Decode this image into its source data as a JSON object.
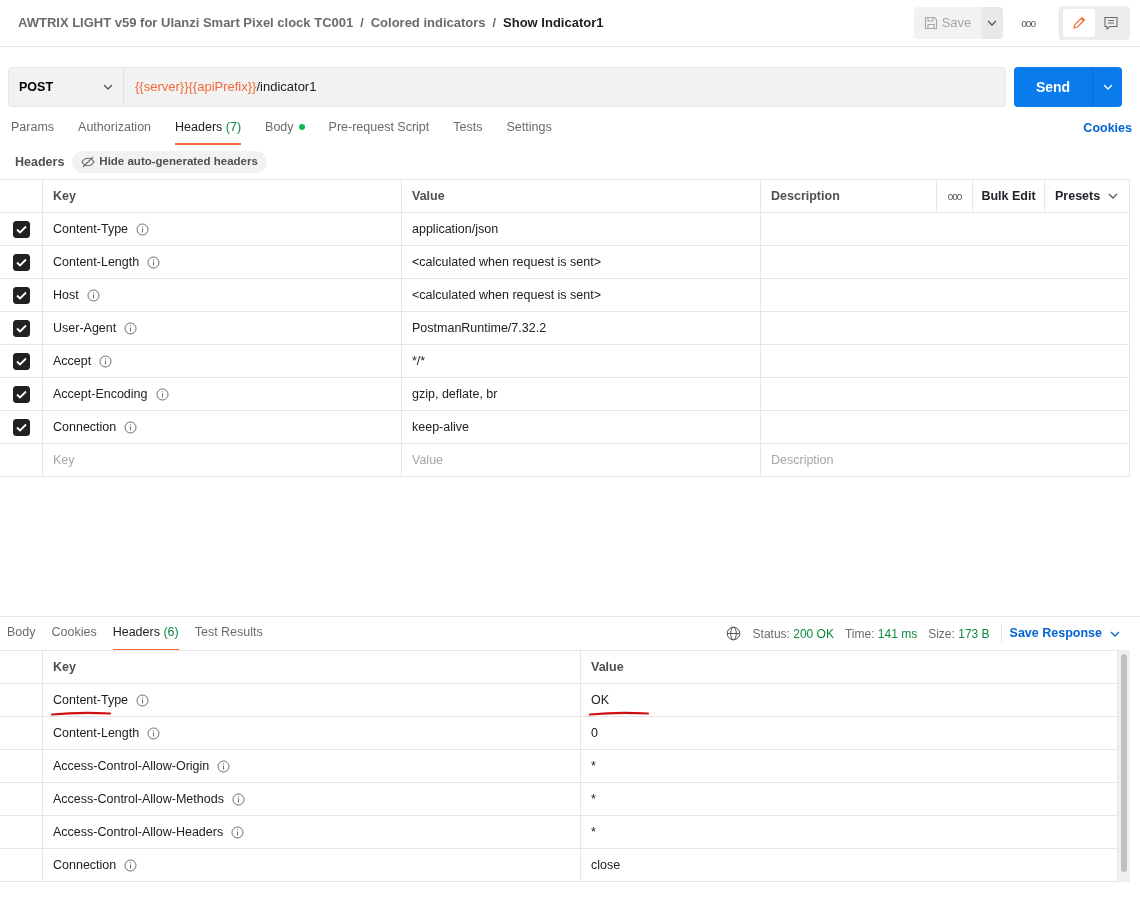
{
  "breadcrumb": [
    {
      "label": "AWTRIX LIGHT v59 for Ulanzi Smart Pixel clock TC001",
      "selected": false
    },
    {
      "label": "Colored indicators",
      "selected": false
    },
    {
      "label": "Show Indicator1",
      "selected": true
    }
  ],
  "breadcrumb_separator": "/",
  "save_button": {
    "label": "Save",
    "disabled": true
  },
  "more_button": "ooo",
  "request": {
    "method": "POST",
    "url_variables": [
      "{{server}}",
      "{{apiPrefix}}"
    ],
    "url_path": "/indicator1",
    "send": "Send"
  },
  "request_tabs": [
    {
      "label": "Params",
      "selected": false
    },
    {
      "label": "Authorization",
      "selected": false
    },
    {
      "label": "Headers",
      "count": "(7)",
      "selected": true
    },
    {
      "label": "Body",
      "dot": true,
      "selected": false
    },
    {
      "label": "Pre-request Script",
      "selected": false
    },
    {
      "label": "Tests",
      "selected": false
    },
    {
      "label": "Settings",
      "selected": false
    }
  ],
  "cookies_link": "Cookies",
  "headers_bar": {
    "title": "Headers",
    "toggle": "Hide auto-generated headers"
  },
  "headers_table": {
    "columns": [
      "Key",
      "Value",
      "Description"
    ],
    "more": "ooo",
    "bulk_edit": "Bulk Edit",
    "presets": "Presets",
    "rows": [
      {
        "key": "Content-Type",
        "value": "application/json",
        "checked": true
      },
      {
        "key": "Content-Length",
        "value": "<calculated when request is sent>",
        "checked": true
      },
      {
        "key": "Host",
        "value": "<calculated when request is sent>",
        "checked": true
      },
      {
        "key": "User-Agent",
        "value": "PostmanRuntime/7.32.2",
        "checked": true
      },
      {
        "key": "Accept",
        "value": "*/*",
        "checked": true
      },
      {
        "key": "Accept-Encoding",
        "value": "gzip, deflate, br",
        "checked": true
      },
      {
        "key": "Connection",
        "value": "keep-alive",
        "checked": true
      }
    ],
    "new_row": {
      "key_placeholder": "Key",
      "value_placeholder": "Value",
      "description_placeholder": "Description"
    }
  },
  "response_tabs": [
    {
      "label": "Body",
      "selected": false
    },
    {
      "label": "Cookies",
      "selected": false
    },
    {
      "label": "Headers",
      "count": "(6)",
      "selected": true
    },
    {
      "label": "Test Results",
      "selected": false
    }
  ],
  "response_meta": [
    {
      "label": "Status:",
      "value": "200 OK"
    },
    {
      "label": "Time:",
      "value": "141 ms"
    },
    {
      "label": "Size:",
      "value": "173 B"
    }
  ],
  "save_response": "Save Response",
  "response_table": {
    "columns": [
      "Key",
      "Value"
    ],
    "rows": [
      {
        "key": "Content-Type",
        "value": "OK",
        "marked": true
      },
      {
        "key": "Content-Length",
        "value": "0",
        "marked": false
      },
      {
        "key": "Access-Control-Allow-Origin",
        "value": "*",
        "marked": false
      },
      {
        "key": "Access-Control-Allow-Methods",
        "value": "*",
        "marked": false
      },
      {
        "key": "Access-Control-Allow-Headers",
        "value": "*",
        "marked": false
      },
      {
        "key": "Connection",
        "value": "close",
        "marked": false
      }
    ]
  }
}
